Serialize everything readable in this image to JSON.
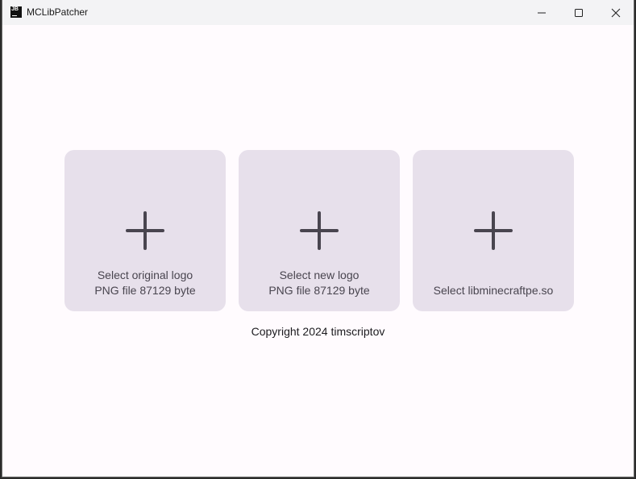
{
  "window": {
    "title": "MCLibPatcher",
    "app_icon": "JB"
  },
  "cards": [
    {
      "line1": "Select original logo",
      "line2": "PNG file 87129 byte",
      "icon": "plus-icon"
    },
    {
      "line1": "Select new logo",
      "line2": "PNG file 87129 byte",
      "icon": "plus-icon"
    },
    {
      "line1": "Select libminecraftpe.so",
      "icon": "plus-icon"
    }
  ],
  "footer": {
    "copyright": "Copyright 2024 timscriptov"
  },
  "colors": {
    "background": "#fffbfe",
    "card": "#e7e0eb",
    "icon": "#49454f"
  }
}
